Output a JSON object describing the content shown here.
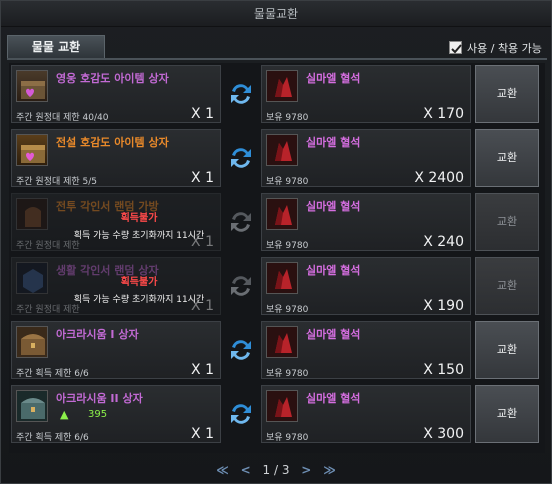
{
  "window": {
    "title": "물물교환"
  },
  "tab": {
    "label": "물물 교환"
  },
  "option": {
    "label": "사용 / 착용 가능",
    "checked": true
  },
  "rows": [
    {
      "src_name": "영웅 호감도 아이템 상자",
      "src_color": "#c26ad4",
      "src_sub": "주간 원정대 제한 40/40",
      "src_qty": "X 1",
      "dst_name": "실마엘 혈석",
      "dst_own": "보유 9780",
      "dst_qty": "X 170",
      "button": "교환",
      "locked": false
    },
    {
      "src_name": "전설 호감도 아이템 상자",
      "src_color": "#ea8a2a",
      "src_sub": "주간 원정대 제한 5/5",
      "src_qty": "X 1",
      "dst_name": "실마엘 혈석",
      "dst_own": "보유 9780",
      "dst_qty": "X 2400",
      "button": "교환",
      "locked": false
    },
    {
      "src_name": "전투 각인서 랜덤 가방",
      "src_color": "#ea8a2a",
      "src_sub": "주간 원정대 제한",
      "src_qty": "X 1",
      "dst_name": "실마엘 혈석",
      "dst_own": "보유 9780",
      "dst_qty": "X 240",
      "button": "교환",
      "locked": true,
      "lock_title": "획득불가",
      "lock_desc": "획득 가능 수량 초기화까지 11시간"
    },
    {
      "src_name": "생활 각인서 랜덤 상자",
      "src_color": "#c26ad4",
      "src_sub": "주간 원정대 제한",
      "src_qty": "X 1",
      "dst_name": "실마엘 혈석",
      "dst_own": "보유 9780",
      "dst_qty": "X 190",
      "button": "교환",
      "locked": true,
      "lock_title": "획득불가",
      "lock_desc": "획득 가능 수량 초기화까지 11시간"
    },
    {
      "src_name": "아크라시움 I 상자",
      "src_color": "#c26ad4",
      "src_sub": "주간 획득 제한 6/6",
      "src_qty": "X 1",
      "dst_name": "실마엘 혈석",
      "dst_own": "보유 9780",
      "dst_qty": "X 150",
      "button": "교환",
      "locked": false
    },
    {
      "src_name": "아크라시움 II 상자",
      "src_color": "#c26ad4",
      "src_sub": "주간 획득 제한 6/6",
      "src_qty": "X 1",
      "src_extra": "395",
      "dst_name": "실마엘 혈석",
      "dst_own": "보유 9780",
      "dst_qty": "X 300",
      "button": "교환",
      "locked": false
    }
  ],
  "pager": {
    "text": "1 / 3",
    "first": "≪",
    "prev": "<",
    "next": ">",
    "last": "≫"
  },
  "colors": {
    "accent": "#2f8ed8",
    "owned_ok": "#8cf04a",
    "warn": "#ff4a4a"
  }
}
